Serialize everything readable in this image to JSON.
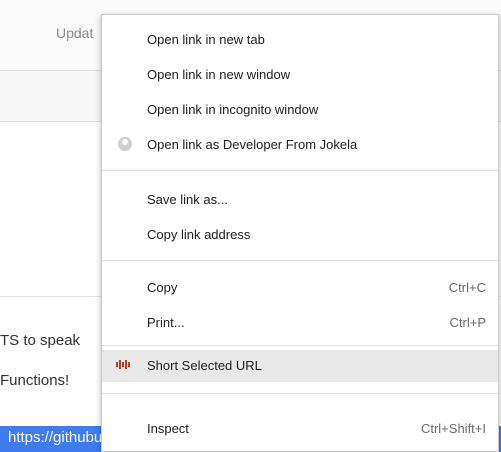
{
  "background": {
    "update_fragment": "Updat",
    "line1": "TS to speak",
    "line2": "Functions!",
    "url_fragment": "https://githubusercontent.com/minhhao/user/s/...-ru/rawn"
  },
  "menu": {
    "items": [
      {
        "label": "Open link in new tab"
      },
      {
        "label": "Open link in new window"
      },
      {
        "label": "Open link in incognito window"
      },
      {
        "label": "Open link as Developer From Jokela",
        "icon": "profile-avatar-icon"
      },
      {
        "label": "Save link as..."
      },
      {
        "label": "Copy link address"
      },
      {
        "label": "Copy",
        "shortcut": "Ctrl+C"
      },
      {
        "label": "Print...",
        "shortcut": "Ctrl+P"
      },
      {
        "label": "Short Selected URL",
        "icon": "short-url-extension-icon"
      },
      {
        "label": "Inspect",
        "shortcut": "Ctrl+Shift+I"
      }
    ]
  },
  "colors": {
    "selection": "#3e7cf0",
    "menu_hover": "#e8e8e8",
    "extension_icon": "#c0392b"
  }
}
